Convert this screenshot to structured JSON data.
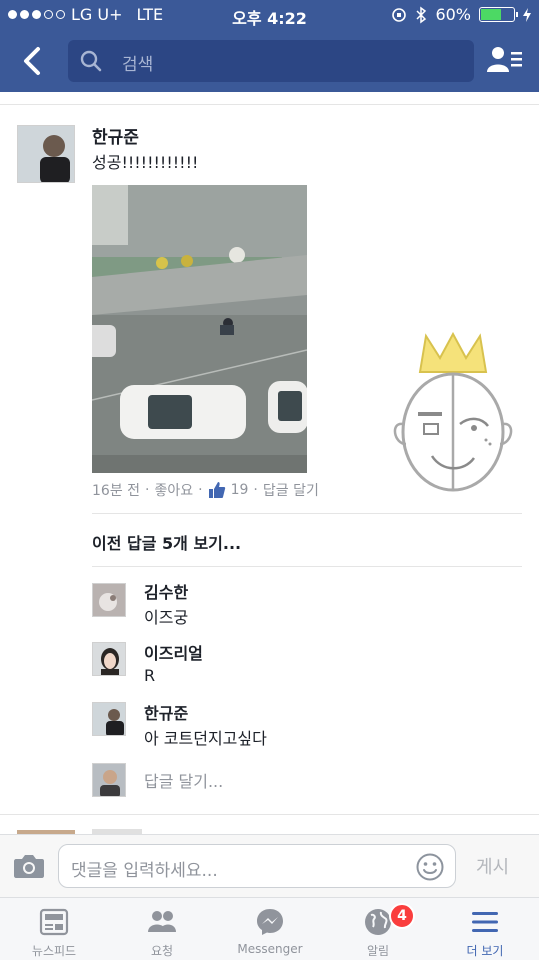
{
  "status_bar": {
    "carrier": "LG U+",
    "network": "LTE",
    "time": "오후 4:22",
    "battery": "60%"
  },
  "nav": {
    "search_placeholder": "검색"
  },
  "post": {
    "author": "한규준",
    "text": "성공!!!!!!!!!!!!",
    "meta": {
      "time": "16분 전",
      "like_label": "좋아요",
      "like_count": "19",
      "reply_label": "답글 달기"
    }
  },
  "replies": {
    "view_previous": "이전 답글 5개 보기...",
    "items": [
      {
        "name": "김수한",
        "text": "이즈궁"
      },
      {
        "name": "이즈리얼",
        "text": "R"
      },
      {
        "name": "한규준",
        "text": "아 코트던지고싶다"
      }
    ],
    "write_reply": "답글 달기..."
  },
  "composer": {
    "placeholder": "댓글을 입력하세요...",
    "post_label": "게시"
  },
  "tabs": [
    {
      "label": "뉴스피드",
      "icon": "news-feed-icon"
    },
    {
      "label": "요청",
      "icon": "friend-requests-icon"
    },
    {
      "label": "Messenger",
      "icon": "messenger-icon"
    },
    {
      "label": "알림",
      "icon": "globe-icon"
    },
    {
      "label": "더 보기",
      "icon": "menu-icon"
    }
  ],
  "notifications_badge": "4",
  "colors": {
    "brand": "#3b5998",
    "active_tab": "#4267b2",
    "badge": "#fa3e3e"
  }
}
